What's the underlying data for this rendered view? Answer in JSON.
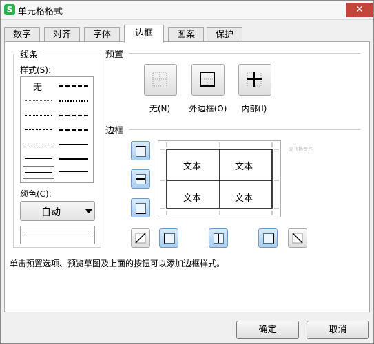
{
  "window": {
    "title": "单元格格式",
    "app_icon": "S",
    "close_glyph": "✕"
  },
  "tabs": [
    {
      "label": "数字"
    },
    {
      "label": "对齐"
    },
    {
      "label": "字体"
    },
    {
      "label": "边框",
      "active": true
    },
    {
      "label": "图案"
    },
    {
      "label": "保护"
    }
  ],
  "line_group": {
    "title": "线条",
    "style_label": "样式(S):",
    "none_label": "无",
    "color_label": "颜色(C):",
    "color_value": "自动"
  },
  "preset_group": {
    "title": "预置",
    "buttons": [
      {
        "label": "无(N)",
        "icon": "no-border-icon"
      },
      {
        "label": "外边框(O)",
        "icon": "outline-border-icon"
      },
      {
        "label": "内部(I)",
        "icon": "inside-border-icon"
      }
    ]
  },
  "border_group": {
    "title": "边框",
    "preview_cells": [
      "文本",
      "文本",
      "文本",
      "文本"
    ]
  },
  "hint": "单击预置选项、预览草图及上面的按钮可以添加边框样式。",
  "watermark": "@飞扬专作",
  "footer": {
    "ok": "确定",
    "cancel": "取消"
  },
  "colors": {
    "close_button": "#c4463a",
    "active_border_button": "#a9cdee",
    "app_icon": "#2bb24c"
  }
}
